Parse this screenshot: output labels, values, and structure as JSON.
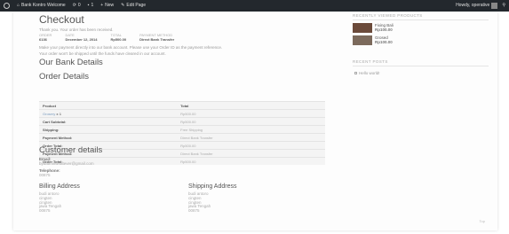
{
  "adminbar": {
    "site_name": "Bank Kontro Welcome",
    "comments_count": "0",
    "updates_count": "1",
    "new_label": "New",
    "edit_page_label": "Edit Page",
    "howdy": "Howdy, operative"
  },
  "checkout": {
    "title": "Checkout",
    "thanks": "Thank you. Your order has been received.",
    "meta": [
      {
        "label": "Order",
        "value": "6136"
      },
      {
        "label": "Date",
        "value": "December 12, 2014"
      },
      {
        "label": "Total",
        "value": "Rp500.00"
      },
      {
        "label": "Payment method",
        "value": "Direct Bank Transfer"
      }
    ],
    "payment_info_1": "Make your payment directly into our bank account. Please use your Order ID as the payment reference.",
    "payment_info_2": "Your order won't be shipped until the funds have cleared in our account.",
    "bank_details_title": "Our Bank Details",
    "order_details_title": "Order Details",
    "table": {
      "headers": [
        "Product",
        "Total"
      ],
      "product": {
        "name": "Grosery",
        "qty": "x 1",
        "total": "Rp500.00"
      },
      "rows": [
        {
          "label": "Cart Subtotal:",
          "value": "Rp500.00"
        },
        {
          "label": "Shipping:",
          "value": "Free Shipping"
        },
        {
          "label": "Payment Method:",
          "value": "Direct Bank Transfer"
        },
        {
          "label": "Order Total:",
          "value": "Rp500.00"
        },
        {
          "label": "Payment Method:",
          "value": "Direct Bank Transfer"
        },
        {
          "label": "Order Total:",
          "value": "Rp500.00"
        }
      ]
    },
    "customer_title": "Customer details",
    "email_label": "Email:",
    "email_value": "bybatminwhatever@gmail.com",
    "telephone_label": "Telephone:",
    "telephone_value": "00875",
    "billing_title": "Billing Address",
    "billing_lines": [
      "budi antoro",
      "cingten",
      "cingten",
      "jawa Tengah",
      "00875"
    ],
    "shipping_title": "Shipping Address",
    "shipping_lines": [
      "budi antoro",
      "cingten",
      "cingten",
      "jawa Tengah",
      "00875"
    ],
    "top_link": "Top"
  },
  "sidebar": {
    "recently_viewed_title": "Recently Viewed Products",
    "products": [
      {
        "name": "Fixing Bali",
        "price": "Rp100.00",
        "thumb_color": "#6b4a3a"
      },
      {
        "name": "Grosed",
        "price": "Rp100.00",
        "thumb_color": "#7c6a5c"
      }
    ],
    "recent_posts_title": "Recent Posts",
    "posts": [
      "Hello world!"
    ]
  }
}
